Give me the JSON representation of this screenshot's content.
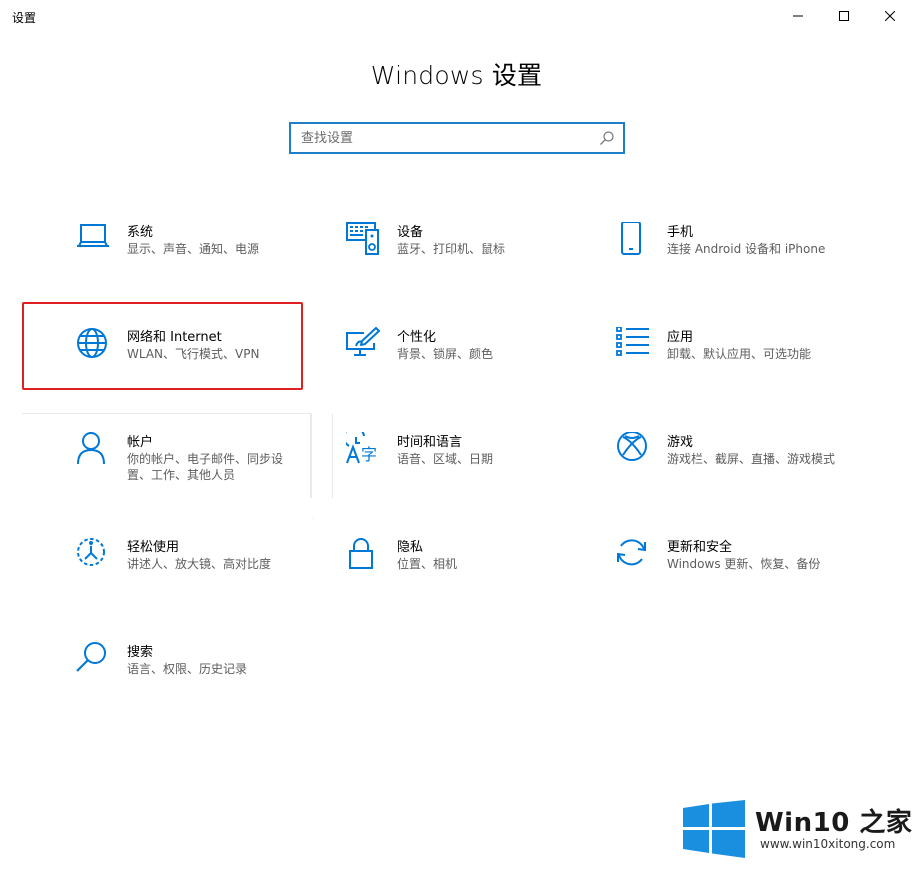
{
  "window": {
    "title": "设置",
    "controls": {
      "minimize": "minimize-icon",
      "maximize": "maximize-icon",
      "close": "close-icon"
    }
  },
  "page": {
    "title": "Windows 设置"
  },
  "search": {
    "placeholder": "查找设置",
    "value": ""
  },
  "tiles": [
    {
      "title": "系统",
      "desc": "显示、声音、通知、电源",
      "icon": "laptop-icon"
    },
    {
      "title": "设备",
      "desc": "蓝牙、打印机、鼠标",
      "icon": "devices-icon"
    },
    {
      "title": "手机",
      "desc": "连接 Android 设备和 iPhone",
      "icon": "phone-icon"
    },
    {
      "title": "网络和 Internet",
      "desc": "WLAN、飞行模式、VPN",
      "icon": "globe-icon"
    },
    {
      "title": "个性化",
      "desc": "背景、锁屏、颜色",
      "icon": "personalization-icon"
    },
    {
      "title": "应用",
      "desc": "卸载、默认应用、可选功能",
      "icon": "apps-list-icon"
    },
    {
      "title": "帐户",
      "desc": "你的帐户、电子邮件、同步设置、工作、其他人员",
      "icon": "person-icon"
    },
    {
      "title": "时间和语言",
      "desc": "语音、区域、日期",
      "icon": "time-language-icon"
    },
    {
      "title": "游戏",
      "desc": "游戏栏、截屏、直播、游戏模式",
      "icon": "xbox-icon"
    },
    {
      "title": "轻松使用",
      "desc": "讲述人、放大镜、高对比度",
      "icon": "ease-of-access-icon"
    },
    {
      "title": "隐私",
      "desc": "位置、相机",
      "icon": "lock-icon"
    },
    {
      "title": "更新和安全",
      "desc": "Windows 更新、恢复、备份",
      "icon": "sync-icon"
    },
    {
      "title": "搜索",
      "desc": "语言、权限、历史记录",
      "icon": "search-magnifier-icon"
    }
  ],
  "watermark": {
    "brand": "Win10 之家",
    "url": "www.win10xitong.com",
    "icon": "windows-logo-icon"
  },
  "colors": {
    "accent": "#0078d7",
    "search_border": "#1c7fc7",
    "highlight": "#e02020",
    "text_secondary": "#5d5d5d"
  }
}
